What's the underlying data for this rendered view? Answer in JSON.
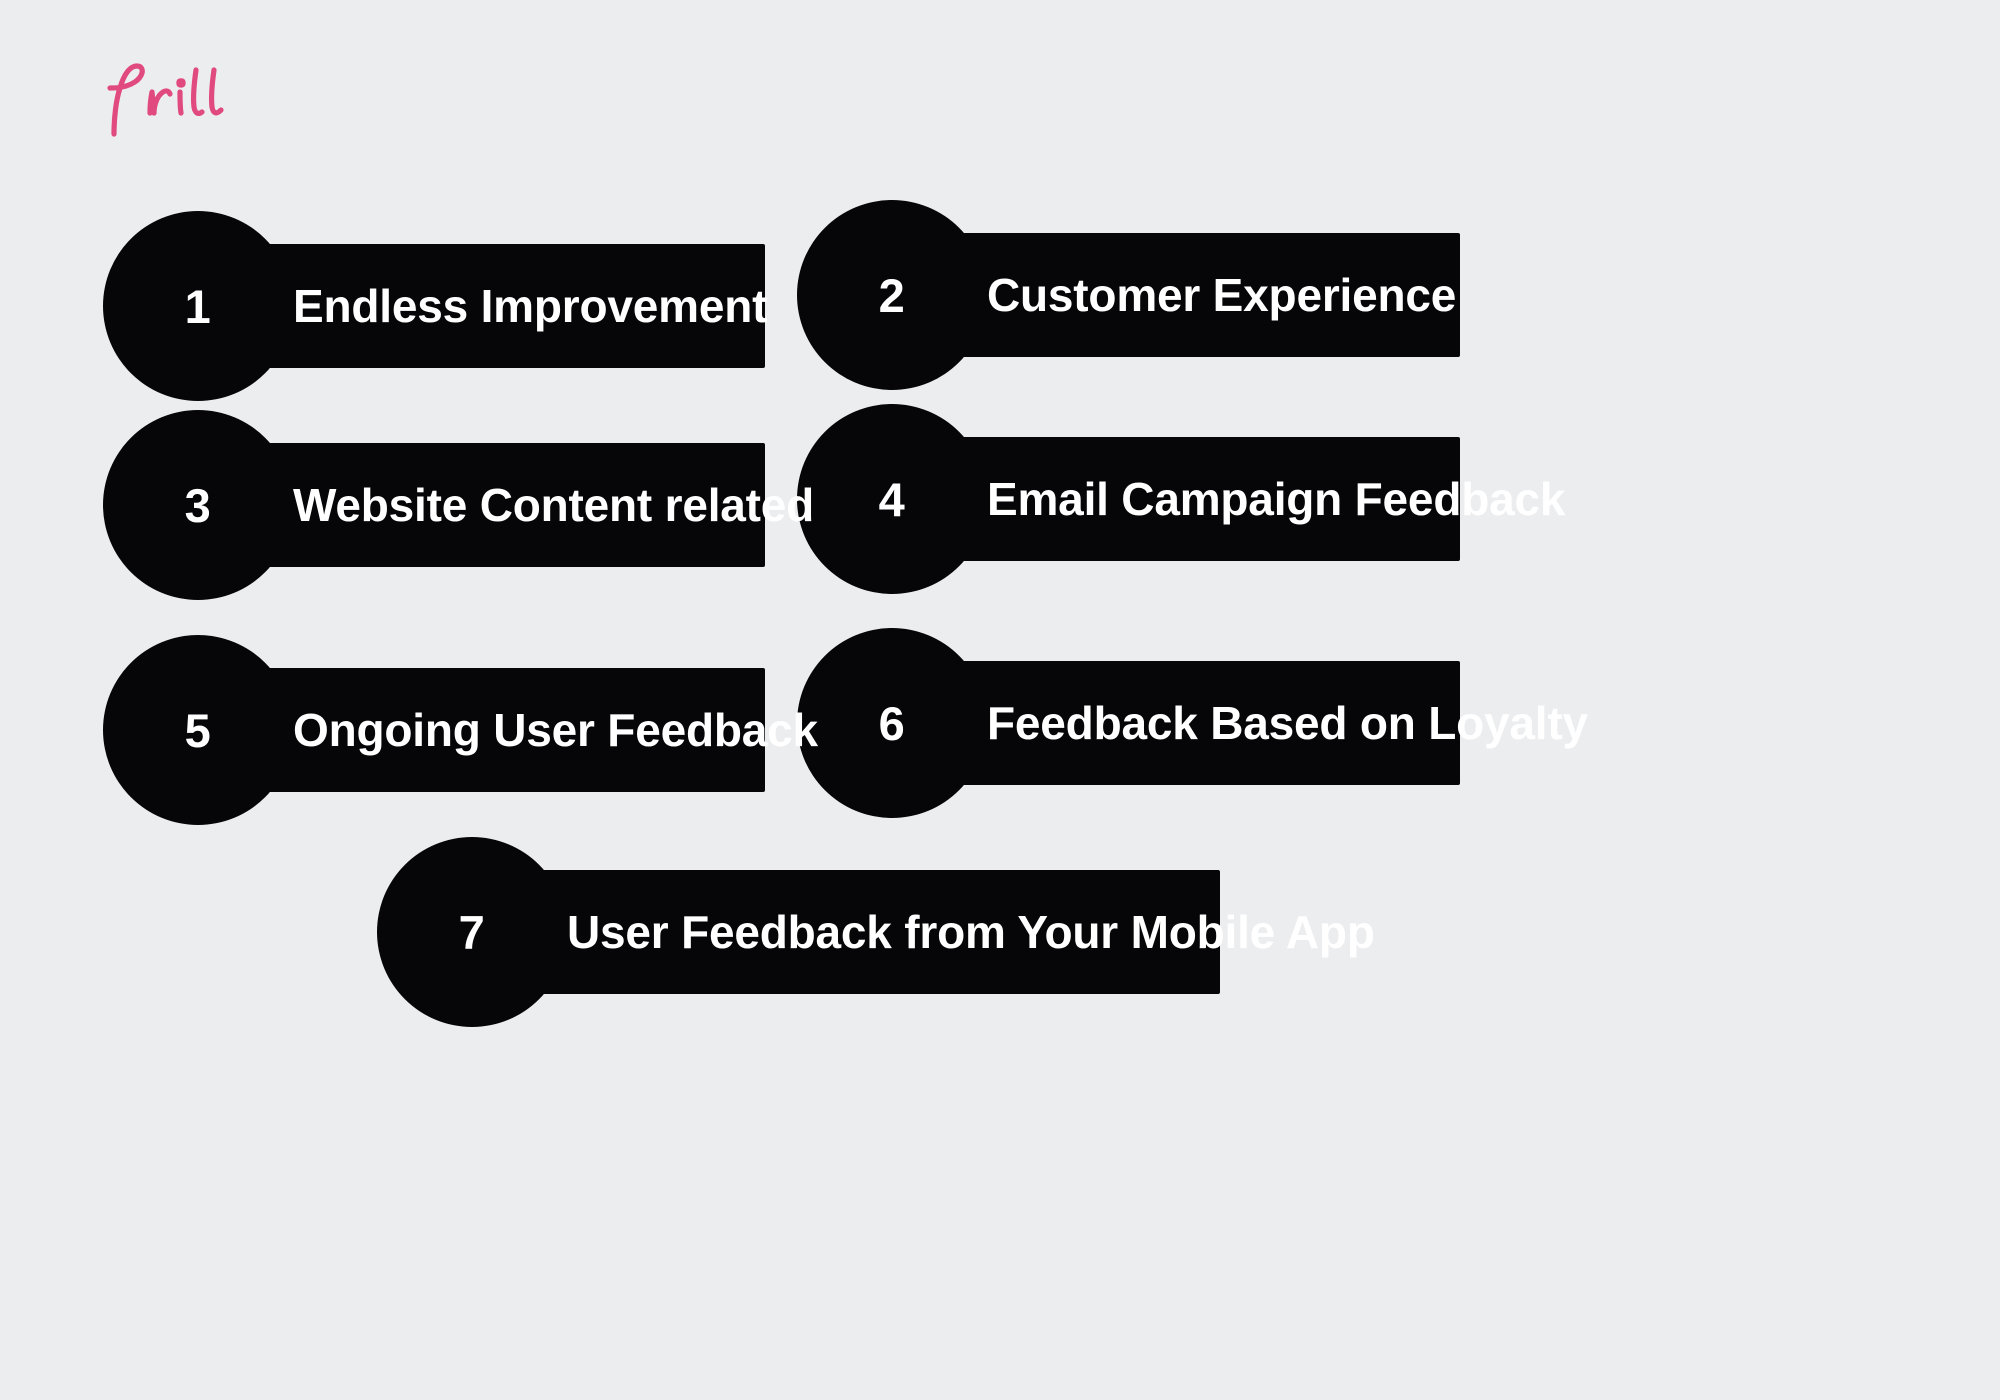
{
  "brand": {
    "name": "frill",
    "logo_color": "#e04a7f"
  },
  "theme": {
    "background": "#ecedef",
    "pill_color": "#060608",
    "pill_text_color": "#ffffff"
  },
  "items": [
    {
      "number": "1",
      "label": "Endless Improvement"
    },
    {
      "number": "2",
      "label": "Customer Experience"
    },
    {
      "number": "3",
      "label": "Website Content related"
    },
    {
      "number": "4",
      "label": "Email Campaign Feedback"
    },
    {
      "number": "5",
      "label": "Ongoing User Feedback"
    },
    {
      "number": "6",
      "label": "Feedback Based on Loyalty"
    },
    {
      "number": "7",
      "label": "User Feedback from Your Mobile App"
    }
  ]
}
